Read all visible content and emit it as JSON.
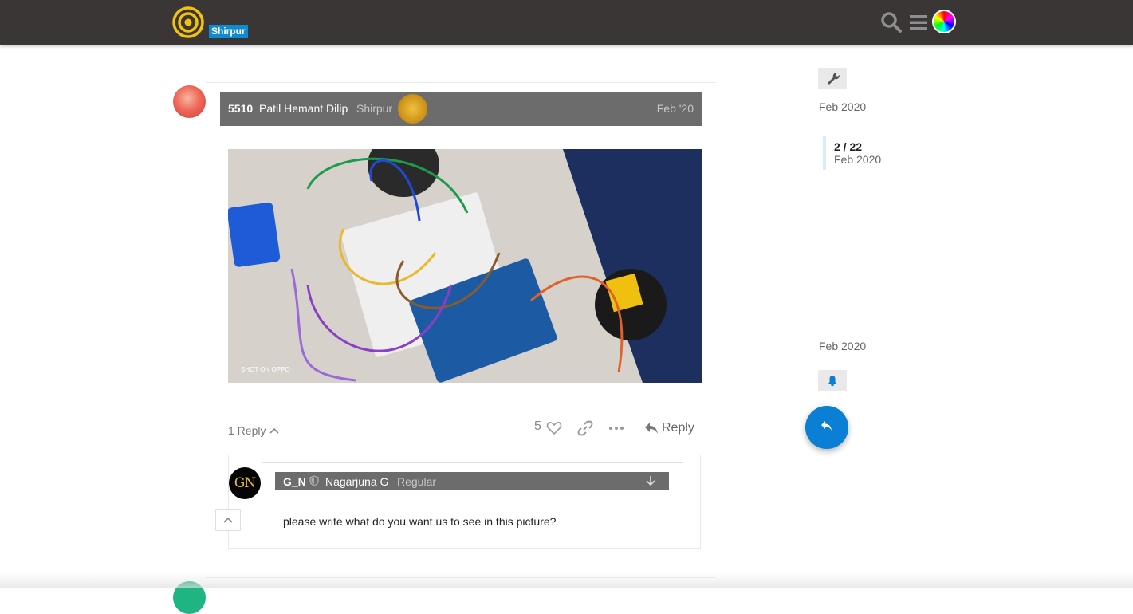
{
  "header": {
    "category_badge": "Shirpur",
    "icons": [
      "logo-icon",
      "search-icon",
      "hamburger-menu-icon",
      "user-avatar"
    ]
  },
  "post": {
    "post_number": "5510",
    "full_name": "Patil Hemant Dilip",
    "group": "Shirpur",
    "date": "Feb '20",
    "image_watermark": "SHOT ON OPPO",
    "replies_toggle": "1 Reply",
    "like_count": "5",
    "reply_label": "Reply"
  },
  "embedded_reply": {
    "avatar_text": "GN",
    "username": "G_N",
    "full_name": "Nagarjuna G",
    "group": "Regular",
    "body": "please write what do you want us to see in this picture?"
  },
  "timeline": {
    "top_date": "Feb 2020",
    "position": "2 / 22",
    "position_date": "Feb 2020",
    "bottom_date": "Feb 2020"
  },
  "colors": {
    "header_bg": "#3b3636",
    "badge": "#0e8bd1",
    "meta_bar": "#6c6c6c",
    "fab": "#0a7fd3"
  }
}
